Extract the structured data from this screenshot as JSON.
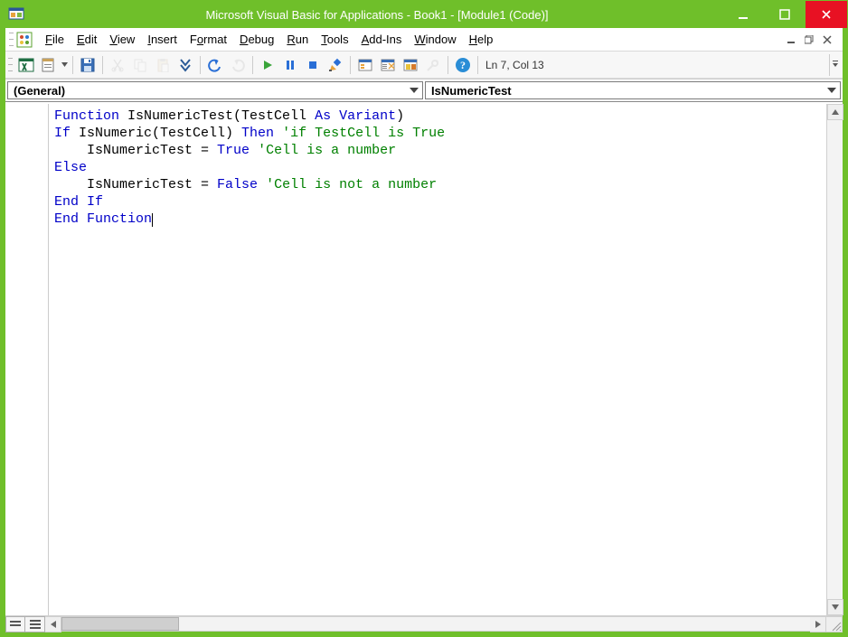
{
  "title": "Microsoft Visual Basic for Applications - Book1 - [Module1 (Code)]",
  "menus": {
    "file": {
      "u": "F",
      "rest": "ile"
    },
    "edit": {
      "u": "E",
      "rest": "dit"
    },
    "view": {
      "u": "V",
      "rest": "iew"
    },
    "insert": {
      "u": "I",
      "rest": "nsert"
    },
    "format": {
      "pre": "F",
      "u": "o",
      "rest": "rmat"
    },
    "debug": {
      "u": "D",
      "rest": "ebug"
    },
    "run": {
      "u": "R",
      "rest": "un"
    },
    "tools": {
      "u": "T",
      "rest": "ools"
    },
    "addins": {
      "u": "A",
      "rest": "dd-Ins"
    },
    "window": {
      "u": "W",
      "rest": "indow"
    },
    "help": {
      "u": "H",
      "rest": "elp"
    }
  },
  "status": {
    "cursor": "Ln 7, Col 13"
  },
  "dropdowns": {
    "object": "(General)",
    "proc": "IsNumericTest"
  },
  "code": {
    "l1": {
      "kw1": "Function",
      "name": " IsNumericTest(TestCell ",
      "kw2": "As Variant",
      "tail": ")"
    },
    "l2": {
      "kw1": "If",
      "mid": " IsNumeric(TestCell) ",
      "kw2": "Then ",
      "cm": "'if TestCell is True"
    },
    "l3": {
      "indent": "    ",
      "txt": "IsNumericTest = ",
      "kw": "True ",
      "cm": "'Cell is a number"
    },
    "l4": {
      "kw": "Else"
    },
    "l5": {
      "indent": "    ",
      "txt": "IsNumericTest = ",
      "kw": "False ",
      "cm": "'Cell is not a number"
    },
    "l6": {
      "kw": "End If"
    },
    "l7": {
      "kw": "End Function"
    }
  }
}
